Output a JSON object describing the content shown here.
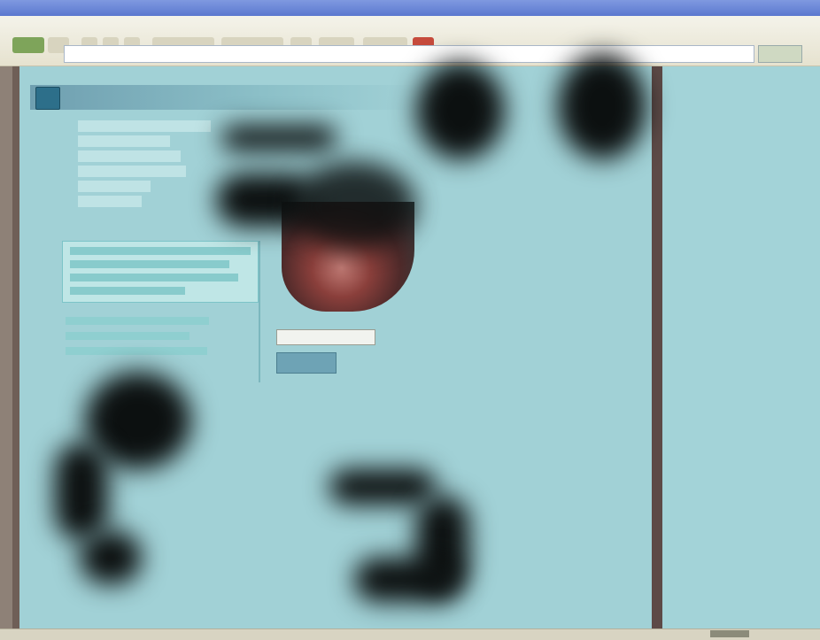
{
  "window": {
    "title": ""
  },
  "toolbar": {
    "buttons": [
      "back",
      "forward",
      "stop",
      "refresh",
      "home",
      "search",
      "favorites",
      "history",
      "mail",
      "print",
      "help"
    ],
    "address_label": "",
    "address_value": "",
    "go_label": ""
  },
  "site": {
    "title": "",
    "menu_items": [
      "",
      "",
      "",
      "",
      "",
      ""
    ],
    "more_link": "",
    "search_value": "",
    "search_button": "",
    "links": [
      "",
      "",
      "",
      ""
    ]
  },
  "colors": {
    "page_background": "#a1d1d6",
    "accent": "#6ea3b5",
    "frame": "#5d4a47",
    "titlebar": "#5b78cf"
  },
  "status": {
    "text": ""
  }
}
